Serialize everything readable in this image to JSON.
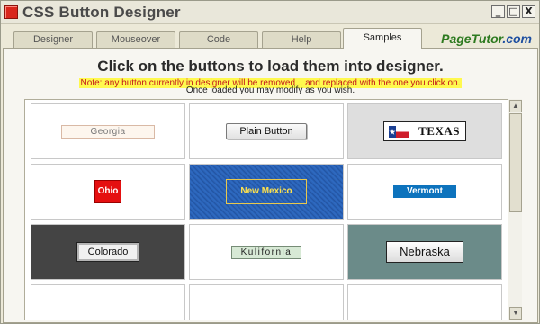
{
  "window": {
    "title": "CSS Button Designer",
    "controls": [
      "_",
      "□",
      "X"
    ]
  },
  "tabs": [
    {
      "label": "Designer",
      "active": false
    },
    {
      "label": "Mouseover",
      "active": false
    },
    {
      "label": "Code",
      "active": false
    },
    {
      "label": "Help",
      "active": false
    },
    {
      "label": "Samples",
      "active": true
    }
  ],
  "brand": {
    "name": "PageTutor",
    "suffix": ".com"
  },
  "content": {
    "heading": "Click on the buttons to load them into designer.",
    "note": "Note: any button currently in designer will be removed... and replaced with the one you click on.",
    "subtext": "Once loaded you may modify as you wish."
  },
  "samples": [
    {
      "label": "Georgia"
    },
    {
      "label": "Plain Button"
    },
    {
      "label": "TEXAS"
    },
    {
      "label": "Ohio"
    },
    {
      "label": "New Mexico"
    },
    {
      "label": "Vermont"
    },
    {
      "label": "Colorado"
    },
    {
      "label": "Kulifornia"
    },
    {
      "label": "Nebraska"
    }
  ],
  "colors": {
    "accent_note_bg": "#fff94e",
    "note_text": "#c3171c",
    "brand_green": "#2d7a1f",
    "brand_blue": "#1e4fa0",
    "app_icon": "#d9261c"
  },
  "icons": {
    "app": "app-icon",
    "scroll_up": "scroll-up-arrow-icon",
    "scroll_down": "scroll-down-arrow-icon",
    "texas_flag": "texas-flag-icon"
  }
}
